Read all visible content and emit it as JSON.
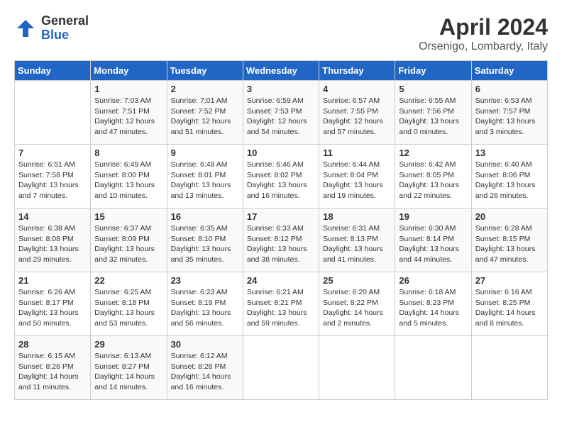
{
  "logo": {
    "general": "General",
    "blue": "Blue"
  },
  "title": "April 2024",
  "location": "Orsenigo, Lombardy, Italy",
  "days_of_week": [
    "Sunday",
    "Monday",
    "Tuesday",
    "Wednesday",
    "Thursday",
    "Friday",
    "Saturday"
  ],
  "weeks": [
    [
      {
        "day": "",
        "info": ""
      },
      {
        "day": "1",
        "info": "Sunrise: 7:03 AM\nSunset: 7:51 PM\nDaylight: 12 hours\nand 47 minutes."
      },
      {
        "day": "2",
        "info": "Sunrise: 7:01 AM\nSunset: 7:52 PM\nDaylight: 12 hours\nand 51 minutes."
      },
      {
        "day": "3",
        "info": "Sunrise: 6:59 AM\nSunset: 7:53 PM\nDaylight: 12 hours\nand 54 minutes."
      },
      {
        "day": "4",
        "info": "Sunrise: 6:57 AM\nSunset: 7:55 PM\nDaylight: 12 hours\nand 57 minutes."
      },
      {
        "day": "5",
        "info": "Sunrise: 6:55 AM\nSunset: 7:56 PM\nDaylight: 13 hours\nand 0 minutes."
      },
      {
        "day": "6",
        "info": "Sunrise: 6:53 AM\nSunset: 7:57 PM\nDaylight: 13 hours\nand 3 minutes."
      }
    ],
    [
      {
        "day": "7",
        "info": "Sunrise: 6:51 AM\nSunset: 7:58 PM\nDaylight: 13 hours\nand 7 minutes."
      },
      {
        "day": "8",
        "info": "Sunrise: 6:49 AM\nSunset: 8:00 PM\nDaylight: 13 hours\nand 10 minutes."
      },
      {
        "day": "9",
        "info": "Sunrise: 6:48 AM\nSunset: 8:01 PM\nDaylight: 13 hours\nand 13 minutes."
      },
      {
        "day": "10",
        "info": "Sunrise: 6:46 AM\nSunset: 8:02 PM\nDaylight: 13 hours\nand 16 minutes."
      },
      {
        "day": "11",
        "info": "Sunrise: 6:44 AM\nSunset: 8:04 PM\nDaylight: 13 hours\nand 19 minutes."
      },
      {
        "day": "12",
        "info": "Sunrise: 6:42 AM\nSunset: 8:05 PM\nDaylight: 13 hours\nand 22 minutes."
      },
      {
        "day": "13",
        "info": "Sunrise: 6:40 AM\nSunset: 8:06 PM\nDaylight: 13 hours\nand 26 minutes."
      }
    ],
    [
      {
        "day": "14",
        "info": "Sunrise: 6:38 AM\nSunset: 8:08 PM\nDaylight: 13 hours\nand 29 minutes."
      },
      {
        "day": "15",
        "info": "Sunrise: 6:37 AM\nSunset: 8:09 PM\nDaylight: 13 hours\nand 32 minutes."
      },
      {
        "day": "16",
        "info": "Sunrise: 6:35 AM\nSunset: 8:10 PM\nDaylight: 13 hours\nand 35 minutes."
      },
      {
        "day": "17",
        "info": "Sunrise: 6:33 AM\nSunset: 8:12 PM\nDaylight: 13 hours\nand 38 minutes."
      },
      {
        "day": "18",
        "info": "Sunrise: 6:31 AM\nSunset: 8:13 PM\nDaylight: 13 hours\nand 41 minutes."
      },
      {
        "day": "19",
        "info": "Sunrise: 6:30 AM\nSunset: 8:14 PM\nDaylight: 13 hours\nand 44 minutes."
      },
      {
        "day": "20",
        "info": "Sunrise: 6:28 AM\nSunset: 8:15 PM\nDaylight: 13 hours\nand 47 minutes."
      }
    ],
    [
      {
        "day": "21",
        "info": "Sunrise: 6:26 AM\nSunset: 8:17 PM\nDaylight: 13 hours\nand 50 minutes."
      },
      {
        "day": "22",
        "info": "Sunrise: 6:25 AM\nSunset: 8:18 PM\nDaylight: 13 hours\nand 53 minutes."
      },
      {
        "day": "23",
        "info": "Sunrise: 6:23 AM\nSunset: 8:19 PM\nDaylight: 13 hours\nand 56 minutes."
      },
      {
        "day": "24",
        "info": "Sunrise: 6:21 AM\nSunset: 8:21 PM\nDaylight: 13 hours\nand 59 minutes."
      },
      {
        "day": "25",
        "info": "Sunrise: 6:20 AM\nSunset: 8:22 PM\nDaylight: 14 hours\nand 2 minutes."
      },
      {
        "day": "26",
        "info": "Sunrise: 6:18 AM\nSunset: 8:23 PM\nDaylight: 14 hours\nand 5 minutes."
      },
      {
        "day": "27",
        "info": "Sunrise: 6:16 AM\nSunset: 8:25 PM\nDaylight: 14 hours\nand 8 minutes."
      }
    ],
    [
      {
        "day": "28",
        "info": "Sunrise: 6:15 AM\nSunset: 8:26 PM\nDaylight: 14 hours\nand 11 minutes."
      },
      {
        "day": "29",
        "info": "Sunrise: 6:13 AM\nSunset: 8:27 PM\nDaylight: 14 hours\nand 14 minutes."
      },
      {
        "day": "30",
        "info": "Sunrise: 6:12 AM\nSunset: 8:28 PM\nDaylight: 14 hours\nand 16 minutes."
      },
      {
        "day": "",
        "info": ""
      },
      {
        "day": "",
        "info": ""
      },
      {
        "day": "",
        "info": ""
      },
      {
        "day": "",
        "info": ""
      }
    ]
  ]
}
